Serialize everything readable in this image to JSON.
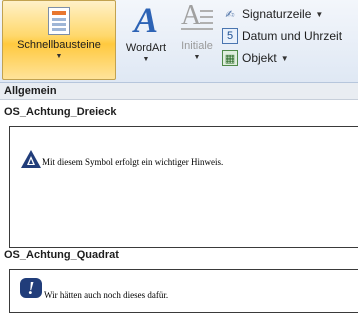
{
  "ribbon": {
    "schnellbausteine_label": "Schnellbausteine",
    "wordart_label": "WordArt",
    "initiale_label": "Initiale",
    "signaturzeile_label": "Signaturzeile",
    "datum_label": "Datum und Uhrzeit",
    "objekt_label": "Objekt"
  },
  "gallery": {
    "category": "Allgemein",
    "entries": [
      {
        "title": "OS_Achtung_Dreieck",
        "preview_text": "Mit diesem Symbol erfolgt ein wichtiger Hinweis."
      },
      {
        "title": "OS_Achtung_Quadrat",
        "preview_text": "Wir hätten auch noch dieses dafür."
      }
    ]
  },
  "colors": {
    "accent_active": "#ffd86b",
    "icon_blue": "#213d7a",
    "wordart_blue": "#2d63b5"
  },
  "icons": [
    "quick-parts-icon",
    "wordart-icon",
    "drop-cap-icon",
    "signature-line-icon",
    "date-time-icon",
    "object-icon",
    "warning-triangle-icon",
    "warning-square-icon"
  ]
}
